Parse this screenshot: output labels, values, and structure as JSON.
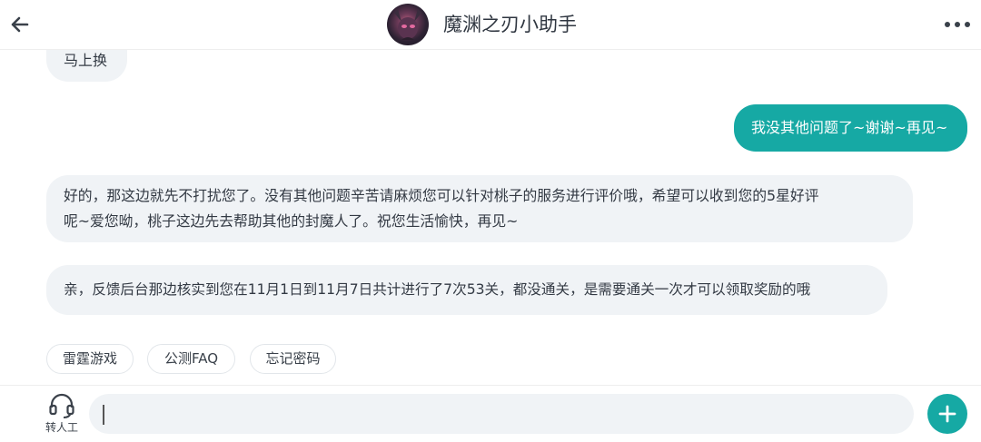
{
  "header": {
    "title": "魔渊之刃小助手",
    "back_icon": "arrow-left-icon",
    "more_icon": "more-dots-icon"
  },
  "messages": [
    {
      "side": "left",
      "text": "马上换"
    },
    {
      "side": "right",
      "text": "我没其他问题了~谢谢~再见~"
    },
    {
      "side": "left",
      "lines": [
        "好的，那这边就先不打扰您了。没有其他问题辛苦请麻烦您可以针对桃子的服务进行评价哦，希望可以收到您的5星好评",
        "呢~爱您呦，桃子这边先去帮助其他的封魔人了。祝您生活愉快，再见~"
      ]
    },
    {
      "side": "left",
      "text": "亲，反馈后台那边核实到您在11月1日到11月7日共计进行了7次53关，都没通关，是需要通关一次才可以领取奖励的哦"
    }
  ],
  "quick_replies": [
    "雷霆游戏",
    "公测FAQ",
    "忘记密码"
  ],
  "footer": {
    "agent_label": "转人工",
    "agent_icon": "headset-icon",
    "add_icon": "plus-icon"
  },
  "colors": {
    "accent": "#16a9a4",
    "bubble_left": "#f0f3f6",
    "text": "#333a44"
  }
}
